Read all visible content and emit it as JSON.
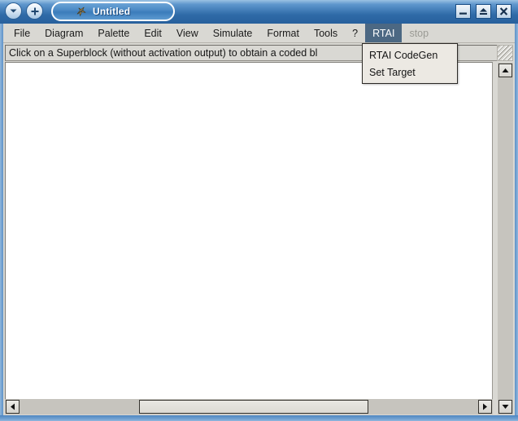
{
  "window": {
    "title": "Untitled",
    "tab_icon": "scilab-icon",
    "nav_back_icon": "chevron-down-icon",
    "nav_add_icon": "plus-icon",
    "minimize_label": "_",
    "maximize_icon": "maximize-icon",
    "close_icon": "close-icon",
    "accent_color": "#3b7cbb",
    "frame_color": "#5e92c8"
  },
  "menubar": {
    "items": [
      {
        "label": "File",
        "state": "normal"
      },
      {
        "label": "Diagram",
        "state": "normal"
      },
      {
        "label": "Palette",
        "state": "normal"
      },
      {
        "label": "Edit",
        "state": "normal"
      },
      {
        "label": "View",
        "state": "normal"
      },
      {
        "label": "Simulate",
        "state": "normal"
      },
      {
        "label": "Format",
        "state": "normal"
      },
      {
        "label": "Tools",
        "state": "normal"
      },
      {
        "label": "?",
        "state": "normal"
      },
      {
        "label": "RTAI",
        "state": "selected"
      },
      {
        "label": "stop",
        "state": "disabled"
      }
    ],
    "selected_color": "#4c6883"
  },
  "dropdown": {
    "owner": "RTAI",
    "items": [
      {
        "label": "RTAI CodeGen"
      },
      {
        "label": "Set Target"
      }
    ]
  },
  "infobar": {
    "text": "Click on a Superblock (without activation output) to obtain a coded bl"
  },
  "canvas": {
    "background": "#ffffff"
  },
  "scrollbars": {
    "vertical": {
      "up_icon": "triangle-up-icon",
      "down_icon": "triangle-down-icon"
    },
    "horizontal": {
      "left_icon": "triangle-left-icon",
      "right_icon": "triangle-right-icon"
    }
  }
}
